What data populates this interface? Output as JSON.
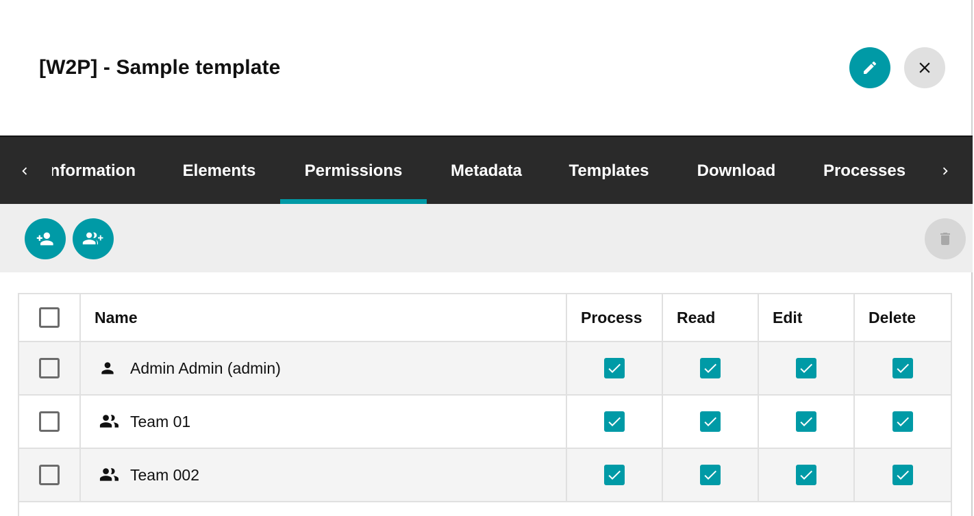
{
  "header": {
    "title": "[W2P] - Sample template",
    "edit_icon": "pencil-icon",
    "close_icon": "close-icon"
  },
  "tabs": {
    "items": [
      {
        "label": "Information",
        "active": false
      },
      {
        "label": "Elements",
        "active": false
      },
      {
        "label": "Permissions",
        "active": true
      },
      {
        "label": "Metadata",
        "active": false
      },
      {
        "label": "Templates",
        "active": false
      },
      {
        "label": "Download",
        "active": false
      },
      {
        "label": "Processes",
        "active": false
      }
    ],
    "scroll_left_icon": "chevron-left-icon",
    "scroll_right_icon": "chevron-right-icon"
  },
  "toolbar": {
    "add_user_icon": "add-user-icon",
    "add_group_icon": "add-group-icon",
    "delete_icon": "trash-icon"
  },
  "table": {
    "columns": {
      "name": "Name",
      "process": "Process",
      "read": "Read",
      "edit": "Edit",
      "delete": "Delete"
    },
    "rows": [
      {
        "name": "Admin Admin (admin)",
        "type": "user",
        "icon": "person-icon",
        "selected": false,
        "process": true,
        "read": true,
        "edit": true,
        "delete": true
      },
      {
        "name": "Team 01",
        "type": "group",
        "icon": "group-icon",
        "selected": false,
        "process": true,
        "read": true,
        "edit": true,
        "delete": true
      },
      {
        "name": "Team 002",
        "type": "group",
        "icon": "group-icon",
        "selected": false,
        "process": true,
        "read": true,
        "edit": true,
        "delete": true
      }
    ]
  },
  "colors": {
    "accent": "#009aa6",
    "tabbar_bg": "#2a2a2a",
    "toolbar_bg": "#eeeeee"
  }
}
